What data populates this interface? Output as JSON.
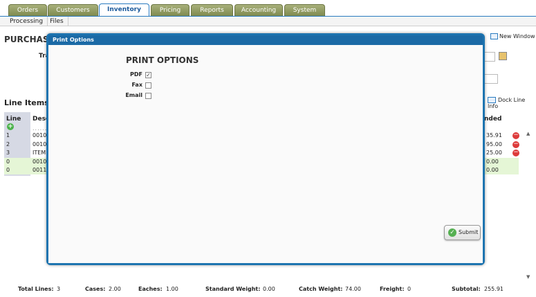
{
  "nav": {
    "tabs": [
      "Orders",
      "Customers",
      "Inventory",
      "Pricing",
      "Reports",
      "Accounting",
      "System"
    ],
    "active_tab": "Inventory",
    "subtabs": [
      "Processing",
      "Files"
    ]
  },
  "page": {
    "title": "PURCHASE",
    "tra_label": "Tra",
    "new_window": "New Window"
  },
  "line_items": {
    "title": "Line Items",
    "dock_info": "Dock Line Info",
    "col_line": "Line",
    "col_desc": "Desc",
    "col_extended": "nded",
    "dots": "......",
    "rows": [
      {
        "line": "1",
        "desc": "0010",
        "ext": "35.91"
      },
      {
        "line": "2",
        "desc": "0010",
        "ext": "95.00"
      },
      {
        "line": "3",
        "desc": "ITEM",
        "ext": "25.00"
      },
      {
        "line": "0",
        "desc": "0010",
        "ext": "0.00"
      },
      {
        "line": "0",
        "desc": "0011",
        "ext": "0.00"
      }
    ]
  },
  "footer": {
    "total_lines_label": "Total Lines:",
    "total_lines": "3",
    "cases_label": "Cases:",
    "cases": "2.00",
    "eaches_label": "Eaches:",
    "eaches": "1.00",
    "std_weight_label": "Standard Weight:",
    "std_weight": "0.00",
    "catch_weight_label": "Catch Weight:",
    "catch_weight": "74.00",
    "freight_label": "Freight:",
    "freight": "0",
    "subtotal_label": "Subtotal:",
    "subtotal": "255.91"
  },
  "modal": {
    "title": "Print Options",
    "heading": "PRINT OPTIONS",
    "options": [
      {
        "label": "PDF",
        "checked": true
      },
      {
        "label": "Fax",
        "checked": false
      },
      {
        "label": "Email",
        "checked": false
      }
    ],
    "submit": "Submit"
  },
  "colors": {
    "accent": "#1b6aa6",
    "tab": "#8e9a5e",
    "green_row": "#e5f6d6"
  }
}
